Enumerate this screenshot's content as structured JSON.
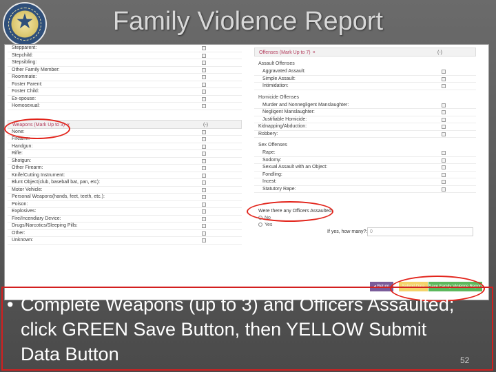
{
  "slide": {
    "title": "Family Violence Report",
    "bullet": "Complete Weapons (up to 3) and Officers Assaulted; click GREEN Save Button, then YELLOW Submit Data Button",
    "bullet_mark": "•",
    "number": "52"
  },
  "relationships": [
    "Stepparent:",
    "Stepchild:",
    "Stepsibling:",
    "Other Family Member:",
    "Roommate:",
    "Foster Parent:",
    "Foster Child:",
    "Ex-spouse:",
    "Homosexual:"
  ],
  "weapons": {
    "header": "Weapons (Mark Up to 3)",
    "close": "×",
    "chevron": "(-)",
    "items": [
      "None:",
      "Firearm:",
      "Handgun:",
      "Rifle:",
      "Shotgun:",
      "Other Firearm:",
      "Knife/Cutting Instrument:",
      "Blunt Object(club, baseball bat, pan, etc):",
      "Motor Vehicle:",
      "Personal Weapons(hands, feet, teeth, etc.):",
      "Poison:",
      "Explosives:",
      "Fire/Incendiary Device:",
      "Drugs/Narcotics/Sleeping Pills:",
      "Other:",
      "Unknown:"
    ]
  },
  "offenses": {
    "header": "Offenses (Mark Up to 7)",
    "close": "×",
    "chevron": "(-)",
    "assault_label": "Assault Offenses",
    "assault_items": [
      "Aggravated Assault:",
      "Simple Assault:",
      "Intimidation:"
    ],
    "homicide_label": "Homicide Offenses",
    "homicide_items": [
      "Murder and Nonnegligent Manslaughter:",
      "Negligent Manslaughter:",
      "Justifiable Homicide:"
    ],
    "kidnapping": "Kidnapping/Abduction:",
    "robbery": "Robbery:",
    "sex_label": "Sex Offenses",
    "sex_items": [
      "Rape:",
      "Sodomy:",
      "Sexual Assault with an Object:",
      "Fondling:",
      "Incest:",
      "Statutory Rape:"
    ]
  },
  "officers": {
    "question": "Were there any Officers Assaulted:",
    "no_label": "No",
    "yes_label": "Yes",
    "how_many_label": "If yes, how many?:",
    "how_many_value": "0"
  },
  "buttons": {
    "return": "◂ Return",
    "submit": "Submit Data",
    "save": "Save Family Violence Report"
  },
  "colors": {
    "annotation": "#e2231a",
    "save_button": "#5cb85c",
    "submit_button": "#f4d36a",
    "return_button": "#7a5c9a"
  }
}
